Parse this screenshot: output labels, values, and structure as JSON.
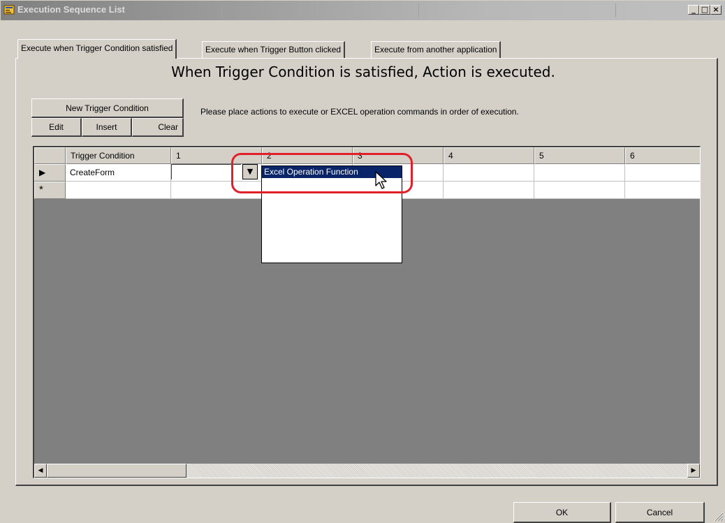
{
  "window": {
    "title": "Execution Sequence List",
    "controls": {
      "minimize": "_",
      "maximize": "□",
      "close": "×"
    }
  },
  "tabs": [
    {
      "label": "Execute when Trigger Condition satisfied",
      "active": true
    },
    {
      "label": "Execute when Trigger Button clicked",
      "active": false
    },
    {
      "label": "Execute from another application",
      "active": false
    }
  ],
  "heading": "When Trigger Condition is satisfied, Action is executed.",
  "toolbar": {
    "new_trigger_label": "New Trigger Condition",
    "edit_label": "Edit",
    "insert_label": "Insert",
    "clear_label": "Clear"
  },
  "instruction": "Please place actions to execute or EXCEL operation commands in order of execution.",
  "grid": {
    "columns": [
      "Trigger Condition",
      "1",
      "2",
      "3",
      "4",
      "5",
      "6"
    ],
    "rows": [
      {
        "marker": "▶",
        "trigger": "CreateForm",
        "cell1": ""
      },
      {
        "marker": "*",
        "trigger": ""
      }
    ]
  },
  "dropdown": {
    "options": [
      "Excel Operation Function"
    ],
    "selected": "Excel Operation Function"
  },
  "footer": {
    "ok_label": "OK",
    "cancel_label": "Cancel"
  },
  "colors": {
    "highlight": "#e0202a",
    "selection": "#0a246a",
    "face": "#d4d0c8"
  }
}
